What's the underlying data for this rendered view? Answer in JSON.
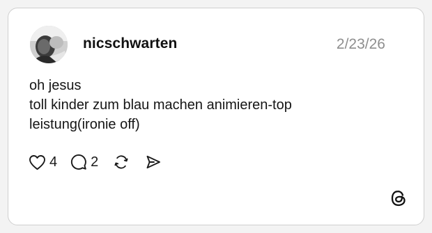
{
  "post": {
    "username": "nicschwarten",
    "timestamp": "2/23/26",
    "text_lines": [
      "oh jesus",
      "toll kinder zum blau machen animieren-top",
      "leistung(ironie off)"
    ]
  },
  "actions": {
    "like": {
      "icon": "heart-icon",
      "count": "4"
    },
    "reply": {
      "icon": "comment-icon",
      "count": "2"
    },
    "repost": {
      "icon": "repost-icon"
    },
    "share": {
      "icon": "send-icon"
    }
  },
  "branding": {
    "icon": "threads-logo-icon"
  },
  "colors": {
    "background": "#f3f3f3",
    "card": "#ffffff",
    "border": "#cfcfcf",
    "text": "#111111",
    "muted": "#8e8e8e"
  }
}
